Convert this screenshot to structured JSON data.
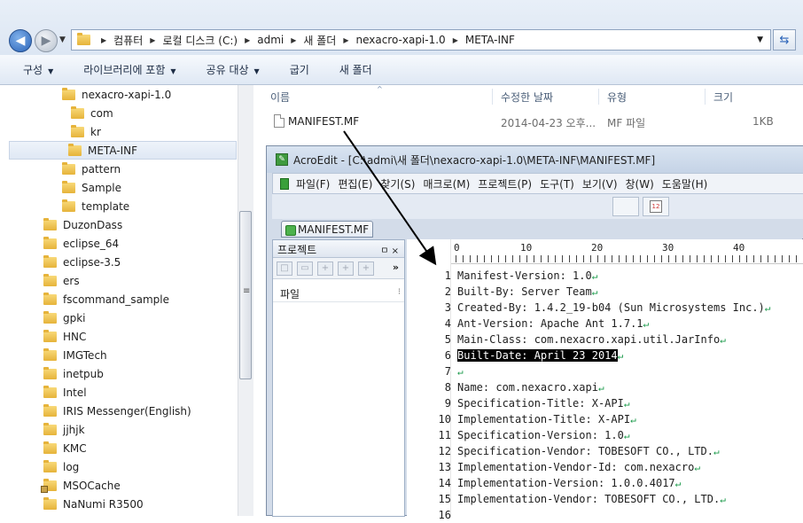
{
  "explorer": {
    "address": {
      "crumbs": [
        "컴퓨터",
        "로컬 디스크 (C:)",
        "admi",
        "새 폴더",
        "nexacro-xapi-1.0",
        "META-INF"
      ]
    },
    "commands": [
      "구성",
      "라이브러리에 포함",
      "공유 대상",
      "굽기",
      "새 폴더"
    ],
    "tree": [
      {
        "label": "nexacro-xapi-1.0",
        "level": 2
      },
      {
        "label": "com",
        "level": 3
      },
      {
        "label": "kr",
        "level": 3
      },
      {
        "label": "META-INF",
        "level": 3,
        "selected": true
      },
      {
        "label": "pattern",
        "level": 2
      },
      {
        "label": "Sample",
        "level": 2
      },
      {
        "label": "template",
        "level": 2
      },
      {
        "label": "DuzonDass",
        "level": 1
      },
      {
        "label": "eclipse_64",
        "level": 1
      },
      {
        "label": "eclipse-3.5",
        "level": 1
      },
      {
        "label": "ers",
        "level": 1
      },
      {
        "label": "fscommand_sample",
        "level": 1
      },
      {
        "label": "gpki",
        "level": 1
      },
      {
        "label": "HNC",
        "level": 1
      },
      {
        "label": "IMGTech",
        "level": 1
      },
      {
        "label": "inetpub",
        "level": 1
      },
      {
        "label": "Intel",
        "level": 1
      },
      {
        "label": "IRIS Messenger(English)",
        "level": 1
      },
      {
        "label": "jjhjk",
        "level": 1
      },
      {
        "label": "KMC",
        "level": 1
      },
      {
        "label": "log",
        "level": 1
      },
      {
        "label": "MSOCache",
        "level": 1,
        "locked": true
      },
      {
        "label": "NaNumi R3500",
        "level": 1
      }
    ],
    "columns": {
      "name": "이름",
      "modified": "수정한 날짜",
      "type": "유형",
      "size": "크기"
    },
    "file": {
      "name": "MANIFEST.MF",
      "modified": "2014-04-23 오후...",
      "type": "MF 파일",
      "size": "1KB"
    }
  },
  "acroedit": {
    "title": "AcroEdit - [C:\\admi\\새 폴더\\nexacro-xapi-1.0\\META-INF\\MANIFEST.MF]",
    "menu": [
      "파일(F)",
      "편집(E)",
      "찾기(S)",
      "매크로(M)",
      "프로젝트(P)",
      "도구(T)",
      "보기(V)",
      "창(W)",
      "도움말(H)"
    ],
    "tab": "MANIFEST.MF",
    "project_panel": {
      "title": "프로젝트",
      "pin": "ㅁ ×",
      "file_header": "파일"
    },
    "ruler": [
      "0",
      "10",
      "20",
      "30",
      "40"
    ],
    "lines": [
      {
        "n": "1",
        "text": "Manifest-Version: 1.0"
      },
      {
        "n": "2",
        "text": "Built-By: Server Team"
      },
      {
        "n": "3",
        "text": "Created-By: 1.4.2_19-b04 (Sun Microsystems Inc.)"
      },
      {
        "n": "4",
        "text": "Ant-Version: Apache Ant 1.7.1"
      },
      {
        "n": "5",
        "text": "Main-Class: com.nexacro.xapi.util.JarInfo"
      },
      {
        "n": "6",
        "text": "Built-Date: April 23 2014",
        "highlight": true
      },
      {
        "n": "7",
        "text": ""
      },
      {
        "n": "8",
        "text": "Name: com.nexacro.xapi"
      },
      {
        "n": "9",
        "text": "Specification-Title: X-API"
      },
      {
        "n": "10",
        "text": "Implementation-Title: X-API"
      },
      {
        "n": "11",
        "text": "Specification-Version: 1.0"
      },
      {
        "n": "12",
        "text": "Specification-Vendor: TOBESOFT CO., LTD."
      },
      {
        "n": "13",
        "text": "Implementation-Vendor-Id: com.nexacro"
      },
      {
        "n": "14",
        "text": "Implementation-Version: 1.0.0.4017"
      },
      {
        "n": "15",
        "text": "Implementation-Vendor: TOBESOFT CO., LTD."
      },
      {
        "n": "16",
        "text": ""
      }
    ]
  },
  "colors": {
    "selection_bg": "#000000",
    "return_mark": "#1a9a4a",
    "accent": "#2a63b8"
  }
}
